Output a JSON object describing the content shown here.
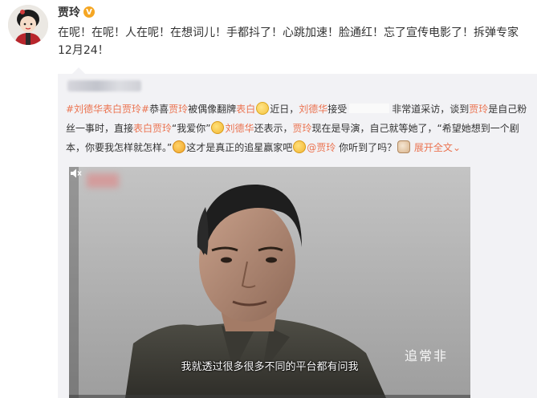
{
  "post": {
    "author": "贾玲",
    "badge": "V",
    "text": "在呢！在呢！人在呢！在想词儿！手都抖了！心跳加速！脸通红！忘了宣传电影了！拆弹专家12月24！"
  },
  "repost": {
    "topic": "#刘德华表白贾玲#",
    "t1": "恭喜",
    "mention_jialing_1": "贾玲",
    "t2": "被偶像翻牌",
    "kw_biaobai_1": "表白",
    "t3": "近日，",
    "kw_liudehua_1": "刘德华",
    "t4": "接受",
    "t5": "非常道采访，谈到",
    "kw_jialing_2": "贾玲",
    "t6": "是自己粉丝一事时，直接",
    "kw_biaobai_jialing": "表白贾玲",
    "t7": "“我爱你”",
    "kw_liudehua_2": "刘德华",
    "t8": "还表示，",
    "kw_jialing_3": "贾玲",
    "t9": "现在是导演，自己就等她了，“希望她想到一个剧本，你要我怎样就怎样。”",
    "t10": "这才是真正的追星赢家吧",
    "mention_jialing": "@贾玲",
    "t11": "你听到了吗？",
    "expand_label": "展开全文",
    "expand_icon": "chevron-down-icon"
  },
  "video": {
    "subtitle": "我就透过很多很多不同的平台都有问我",
    "watermark": "追常非",
    "progress": 0
  },
  "colors": {
    "link": "#eb7350",
    "repost_bg": "#f2f2f5",
    "progress": "#f5a623"
  }
}
